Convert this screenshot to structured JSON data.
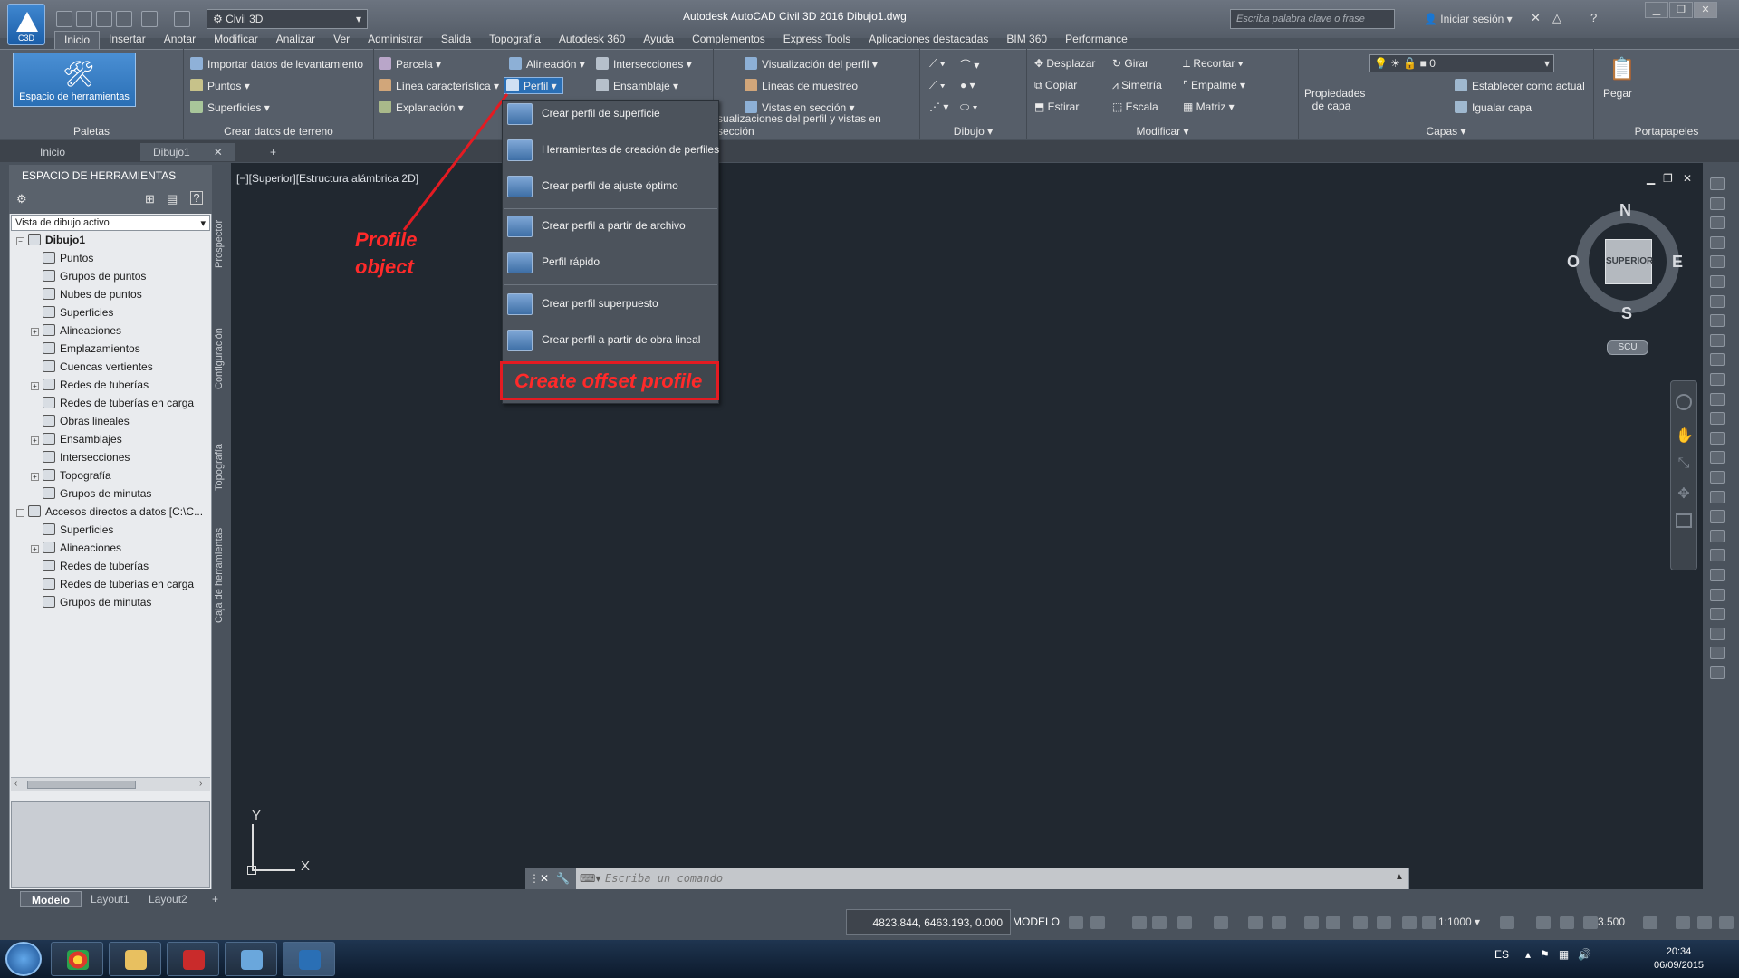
{
  "title_bar": {
    "app_badge": "C3D",
    "workspace": "Civil 3D",
    "title": "Autodesk AutoCAD Civil 3D 2016    Dibujo1.dwg",
    "search_placeholder": "Escriba palabra clave o frase",
    "sign_in": "Iniciar sesión"
  },
  "menu_tabs": [
    "Inicio",
    "Insertar",
    "Anotar",
    "Modificar",
    "Analizar",
    "Ver",
    "Administrar",
    "Salida",
    "Topografía",
    "Autodesk 360",
    "Ayuda",
    "Complementos",
    "Express Tools",
    "Aplicaciones destacadas",
    "BIM 360",
    "Performance"
  ],
  "ribbon": {
    "big_tool": "Espacio de herramientas",
    "panels": {
      "paletas": "Paletas",
      "crear_terreno": "Crear datos de terreno",
      "perfil_vistas": "sualizaciones del perfil y vistas en sección",
      "dibujo": "Dibujo",
      "modificar": "Modificar",
      "capas": "Capas",
      "portapapeles": "Portapapeles"
    },
    "items": {
      "importar": "Importar datos de levantamiento",
      "puntos": "Puntos",
      "superficies": "Superficies",
      "parcela": "Parcela",
      "linea_caracteristica": "Línea característica",
      "explanacion": "Explanación",
      "alineacion": "Alineación",
      "perfil": "Perfil",
      "intersecciones": "Intersecciones",
      "ensamblaje": "Ensamblaje",
      "visualizacion_perfil": "Visualización del perfil",
      "lineas_muestreo": "Líneas de muestreo",
      "vistas_seccion": "Vistas en sección",
      "desplazar": "Desplazar",
      "girar": "Girar",
      "recortar": "Recortar",
      "copiar": "Copiar",
      "simetria": "Simetría",
      "empalme": "Empalme",
      "estirar": "Estirar",
      "escala": "Escala",
      "matriz": "Matriz",
      "propiedades_capa": "Propiedades de capa",
      "capa_actual": "0",
      "establecer_actual": "Establecer como actual",
      "igualar_capa": "Igualar capa",
      "pegar": "Pegar"
    }
  },
  "file_tabs": [
    "Inicio",
    "Dibujo1"
  ],
  "toolspace": {
    "title": "ESPACIO DE HERRAMIENTAS",
    "view_select": "Vista de dibujo activo",
    "side_tabs": [
      "Prospector",
      "Configuración",
      "Topografía",
      "Caja de herramientas"
    ],
    "tree": [
      {
        "label": "Dibujo1",
        "level": 0,
        "expand": "−",
        "bold": true
      },
      {
        "label": "Puntos",
        "level": 1,
        "expand": ""
      },
      {
        "label": "Grupos de puntos",
        "level": 1,
        "expand": ""
      },
      {
        "label": "Nubes de puntos",
        "level": 1,
        "expand": ""
      },
      {
        "label": "Superficies",
        "level": 1,
        "expand": ""
      },
      {
        "label": "Alineaciones",
        "level": 1,
        "expand": "+"
      },
      {
        "label": "Emplazamientos",
        "level": 1,
        "expand": ""
      },
      {
        "label": "Cuencas vertientes",
        "level": 1,
        "expand": ""
      },
      {
        "label": "Redes de tuberías",
        "level": 1,
        "expand": "+"
      },
      {
        "label": "Redes de tuberías en carga",
        "level": 1,
        "expand": ""
      },
      {
        "label": "Obras lineales",
        "level": 1,
        "expand": ""
      },
      {
        "label": "Ensamblajes",
        "level": 1,
        "expand": "+"
      },
      {
        "label": "Intersecciones",
        "level": 1,
        "expand": ""
      },
      {
        "label": "Topografía",
        "level": 1,
        "expand": "+"
      },
      {
        "label": "Grupos de minutas",
        "level": 1,
        "expand": ""
      },
      {
        "label": "Accesos directos a datos [C:\\C...",
        "level": 0,
        "expand": "−",
        "bold": false
      },
      {
        "label": "Superficies",
        "level": 1,
        "expand": ""
      },
      {
        "label": "Alineaciones",
        "level": 1,
        "expand": "+"
      },
      {
        "label": "Redes de tuberías",
        "level": 1,
        "expand": ""
      },
      {
        "label": "Redes de tuberías en carga",
        "level": 1,
        "expand": ""
      },
      {
        "label": "Grupos de minutas",
        "level": 1,
        "expand": ""
      }
    ]
  },
  "viewport_label": "[−][Superior][Estructura alámbrica 2D]",
  "perfil_menu": [
    "Crear perfil de superficie",
    "Herramientas de creación de perfiles",
    "Crear perfil de ajuste óptimo",
    "Crear perfil a partir de archivo",
    "Perfil rápido",
    "Crear perfil superpuesto",
    "Crear perfil a partir de obra lineal"
  ],
  "annotations": {
    "profile_object": "Profile object",
    "callout": "Create offset profile",
    "annotation_color": "#e41b22"
  },
  "viewcube": {
    "face": "SUPERIOR",
    "north": "N",
    "south": "S",
    "east": "E",
    "west": "O",
    "ucs": "SCU"
  },
  "ucs_axes": {
    "x": "X",
    "y": "Y"
  },
  "command_line": {
    "placeholder": "Escriba un comando"
  },
  "layout_tabs": [
    "Modelo",
    "Layout1",
    "Layout2"
  ],
  "status_bar": {
    "coords": "4823.844, 6463.193, 0.000",
    "mode": "MODELO",
    "scale": "1:1000",
    "annotation_scale": "3.500"
  },
  "taskbar": {
    "lang": "ES",
    "time": "20:34",
    "date": "06/09/2015"
  },
  "colors": {
    "accent": "#2a6fb5",
    "annotation": "#e41b22",
    "drawing_bg": "#212830"
  }
}
